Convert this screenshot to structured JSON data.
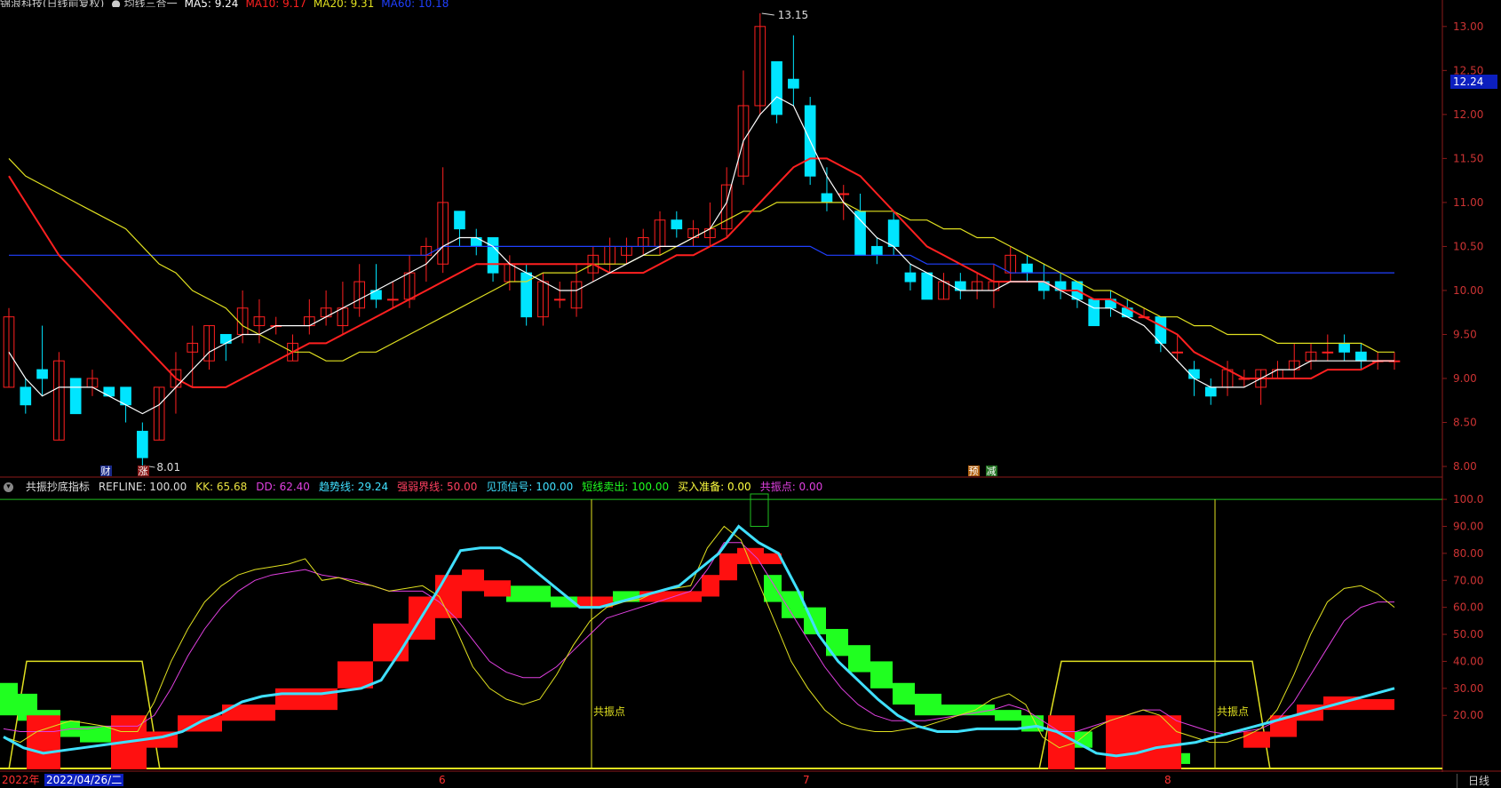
{
  "header": {
    "title_items": [
      {
        "text": "锦浪科技(日线前复权)",
        "color": "#cccccc"
      },
      {
        "text": "● 均线三合一",
        "color": "#cccccc"
      },
      {
        "text": "MA5: 9.24",
        "color": "#ffffff"
      },
      {
        "text": "MA10: 9.17",
        "color": "#ff2020"
      },
      {
        "text": "MA20: 9.31",
        "color": "#e0e020"
      },
      {
        "text": "MA60: 10.18",
        "color": "#2040ff"
      }
    ]
  },
  "indicator_header": {
    "icon": "chevron-down-icon",
    "items": [
      {
        "text": "共振抄底指标",
        "color": "#dddddd"
      },
      {
        "text": "REFLINE: 100.00",
        "color": "#dddddd"
      },
      {
        "text": "KK: 65.68",
        "color": "#e8e040"
      },
      {
        "text": "DD: 62.40",
        "color": "#e040e0"
      },
      {
        "text": "趋势线: 29.24",
        "color": "#40e0ff"
      },
      {
        "text": "强弱界线: 50.00",
        "color": "#ff4060"
      },
      {
        "text": "见顶信号: 100.00",
        "color": "#40e0ff"
      },
      {
        "text": "短线卖出: 100.00",
        "color": "#20ff20"
      },
      {
        "text": "买入准备: 0.00",
        "color": "#ffff40"
      },
      {
        "text": "共振点: 0.00",
        "color": "#e040e0"
      }
    ]
  },
  "price_axis": {
    "ticks": [
      "13.00",
      "12.50",
      "12.00",
      "11.50",
      "11.00",
      "10.50",
      "10.00",
      "9.50",
      "9.00",
      "8.50",
      "8.00"
    ],
    "current": "12.24"
  },
  "indicator_axis": {
    "ticks": [
      "100.0",
      "90.00",
      "80.00",
      "70.00",
      "60.00",
      "50.00",
      "40.00",
      "30.00",
      "20.00"
    ]
  },
  "annotations": {
    "high_label": "13.15",
    "low_label": "8.01",
    "cai": "财",
    "zhang": "涨",
    "yu": "预",
    "jian": "减",
    "gongzhen1": "共振点",
    "gongzhen2": "共振点"
  },
  "bottom_bar": {
    "year": "2022年",
    "date": "2022/04/26/二",
    "months": [
      "6",
      "7",
      "8"
    ],
    "period_button": "日线"
  },
  "colors": {
    "up": "#ff2020",
    "down": "#00e5ff",
    "ma5": "#ffffff",
    "ma10": "#ff2020",
    "ma20": "#e0e020",
    "ma60": "#2040ff"
  },
  "chart_data": [
    {
      "type": "candlestick",
      "title": "锦浪科技(日线前复权)",
      "candles": [
        {
          "o": 8.9,
          "c": 9.7,
          "h": 9.8,
          "l": 8.9
        },
        {
          "o": 8.9,
          "c": 8.7,
          "h": 9.0,
          "l": 8.6
        },
        {
          "o": 9.1,
          "c": 9.0,
          "h": 9.6,
          "l": 8.8
        },
        {
          "o": 8.3,
          "c": 9.2,
          "h": 9.3,
          "l": 8.3
        },
        {
          "o": 9.0,
          "c": 8.6,
          "h": 9.0,
          "l": 8.6
        },
        {
          "o": 8.9,
          "c": 9.0,
          "h": 9.1,
          "l": 8.8
        },
        {
          "o": 8.9,
          "c": 8.8,
          "h": 8.9,
          "l": 8.8
        },
        {
          "o": 8.9,
          "c": 8.7,
          "h": 8.9,
          "l": 8.5
        },
        {
          "o": 8.4,
          "c": 8.1,
          "h": 8.5,
          "l": 8.01
        },
        {
          "o": 8.3,
          "c": 8.9,
          "h": 8.9,
          "l": 8.3
        },
        {
          "o": 8.9,
          "c": 9.1,
          "h": 9.3,
          "l": 8.6
        },
        {
          "o": 9.3,
          "c": 9.4,
          "h": 9.6,
          "l": 8.9
        },
        {
          "o": 9.2,
          "c": 9.6,
          "h": 9.6,
          "l": 9.1
        },
        {
          "o": 9.5,
          "c": 9.4,
          "h": 9.5,
          "l": 9.2
        },
        {
          "o": 9.5,
          "c": 9.8,
          "h": 10.0,
          "l": 9.4
        },
        {
          "o": 9.6,
          "c": 9.7,
          "h": 9.9,
          "l": 9.4
        },
        {
          "o": 9.6,
          "c": 9.6,
          "h": 9.7,
          "l": 9.5
        },
        {
          "o": 9.2,
          "c": 9.4,
          "h": 9.5,
          "l": 9.2
        },
        {
          "o": 9.6,
          "c": 9.7,
          "h": 9.9,
          "l": 9.5
        },
        {
          "o": 9.7,
          "c": 9.8,
          "h": 10.0,
          "l": 9.6
        },
        {
          "o": 9.6,
          "c": 9.8,
          "h": 10.1,
          "l": 9.5
        },
        {
          "o": 9.8,
          "c": 10.1,
          "h": 10.3,
          "l": 9.7
        },
        {
          "o": 10.0,
          "c": 9.9,
          "h": 10.3,
          "l": 9.8
        },
        {
          "o": 9.9,
          "c": 9.9,
          "h": 10.1,
          "l": 9.8
        },
        {
          "o": 9.9,
          "c": 10.2,
          "h": 10.4,
          "l": 9.8
        },
        {
          "o": 10.4,
          "c": 10.5,
          "h": 10.6,
          "l": 10.1
        },
        {
          "o": 10.3,
          "c": 11.0,
          "h": 11.4,
          "l": 10.2
        },
        {
          "o": 10.9,
          "c": 10.7,
          "h": 10.9,
          "l": 10.5
        },
        {
          "o": 10.6,
          "c": 10.5,
          "h": 10.7,
          "l": 10.4
        },
        {
          "o": 10.6,
          "c": 10.2,
          "h": 10.6,
          "l": 10.1
        },
        {
          "o": 10.1,
          "c": 10.3,
          "h": 10.4,
          "l": 10.0
        },
        {
          "o": 10.2,
          "c": 9.7,
          "h": 10.3,
          "l": 9.6
        },
        {
          "o": 9.7,
          "c": 10.1,
          "h": 10.2,
          "l": 9.6
        },
        {
          "o": 9.9,
          "c": 9.9,
          "h": 10.1,
          "l": 9.8
        },
        {
          "o": 9.8,
          "c": 10.1,
          "h": 10.3,
          "l": 9.7
        },
        {
          "o": 10.2,
          "c": 10.4,
          "h": 10.5,
          "l": 10.1
        },
        {
          "o": 10.3,
          "c": 10.5,
          "h": 10.6,
          "l": 10.2
        },
        {
          "o": 10.4,
          "c": 10.5,
          "h": 10.6,
          "l": 10.3
        },
        {
          "o": 10.5,
          "c": 10.6,
          "h": 10.7,
          "l": 10.4
        },
        {
          "o": 10.5,
          "c": 10.8,
          "h": 10.9,
          "l": 10.4
        },
        {
          "o": 10.8,
          "c": 10.7,
          "h": 10.9,
          "l": 10.6
        },
        {
          "o": 10.6,
          "c": 10.7,
          "h": 10.8,
          "l": 10.5
        },
        {
          "o": 10.6,
          "c": 10.7,
          "h": 11.0,
          "l": 10.5
        },
        {
          "o": 10.7,
          "c": 11.2,
          "h": 11.4,
          "l": 10.6
        },
        {
          "o": 11.3,
          "c": 12.1,
          "h": 12.5,
          "l": 11.2
        },
        {
          "o": 12.1,
          "c": 13.0,
          "h": 13.15,
          "l": 12.0
        },
        {
          "o": 12.6,
          "c": 12.0,
          "h": 12.6,
          "l": 11.9
        },
        {
          "o": 12.4,
          "c": 12.3,
          "h": 12.9,
          "l": 12.1
        },
        {
          "o": 12.1,
          "c": 11.3,
          "h": 12.2,
          "l": 11.2
        },
        {
          "o": 11.1,
          "c": 11.0,
          "h": 11.4,
          "l": 10.9
        },
        {
          "o": 11.1,
          "c": 11.1,
          "h": 11.2,
          "l": 10.8
        },
        {
          "o": 10.9,
          "c": 10.4,
          "h": 11.1,
          "l": 10.4
        },
        {
          "o": 10.5,
          "c": 10.4,
          "h": 10.6,
          "l": 10.3
        },
        {
          "o": 10.8,
          "c": 10.5,
          "h": 10.9,
          "l": 10.4
        },
        {
          "o": 10.2,
          "c": 10.1,
          "h": 10.3,
          "l": 10.0
        },
        {
          "o": 10.2,
          "c": 9.9,
          "h": 10.2,
          "l": 9.9
        },
        {
          "o": 9.9,
          "c": 10.1,
          "h": 10.2,
          "l": 9.9
        },
        {
          "o": 10.1,
          "c": 10.0,
          "h": 10.2,
          "l": 9.9
        },
        {
          "o": 10.0,
          "c": 10.1,
          "h": 10.2,
          "l": 9.9
        },
        {
          "o": 10.0,
          "c": 10.1,
          "h": 10.3,
          "l": 9.8
        },
        {
          "o": 10.2,
          "c": 10.4,
          "h": 10.5,
          "l": 10.1
        },
        {
          "o": 10.3,
          "c": 10.2,
          "h": 10.4,
          "l": 10.1
        },
        {
          "o": 10.1,
          "c": 10.0,
          "h": 10.3,
          "l": 9.9
        },
        {
          "o": 10.1,
          "c": 10.0,
          "h": 10.2,
          "l": 9.9
        },
        {
          "o": 10.1,
          "c": 9.9,
          "h": 10.1,
          "l": 9.8
        },
        {
          "o": 9.9,
          "c": 9.6,
          "h": 9.9,
          "l": 9.6
        },
        {
          "o": 9.9,
          "c": 9.8,
          "h": 10.0,
          "l": 9.7
        },
        {
          "o": 9.8,
          "c": 9.7,
          "h": 9.9,
          "l": 9.7
        },
        {
          "o": 9.7,
          "c": 9.7,
          "h": 9.8,
          "l": 9.7
        },
        {
          "o": 9.7,
          "c": 9.4,
          "h": 9.7,
          "l": 9.3
        },
        {
          "o": 9.3,
          "c": 9.3,
          "h": 9.5,
          "l": 9.2
        },
        {
          "o": 9.1,
          "c": 9.0,
          "h": 9.2,
          "l": 8.8
        },
        {
          "o": 8.9,
          "c": 8.8,
          "h": 9.0,
          "l": 8.7
        },
        {
          "o": 8.9,
          "c": 9.1,
          "h": 9.2,
          "l": 8.8
        },
        {
          "o": 9.0,
          "c": 9.0,
          "h": 9.1,
          "l": 8.9
        },
        {
          "o": 8.9,
          "c": 9.1,
          "h": 9.1,
          "l": 8.7
        },
        {
          "o": 9.0,
          "c": 9.1,
          "h": 9.2,
          "l": 9.0
        },
        {
          "o": 9.1,
          "c": 9.2,
          "h": 9.4,
          "l": 9.0
        },
        {
          "o": 9.2,
          "c": 9.3,
          "h": 9.4,
          "l": 9.1
        },
        {
          "o": 9.3,
          "c": 9.3,
          "h": 9.5,
          "l": 9.2
        },
        {
          "o": 9.4,
          "c": 9.3,
          "h": 9.5,
          "l": 9.2
        },
        {
          "o": 9.3,
          "c": 9.2,
          "h": 9.4,
          "l": 9.1
        },
        {
          "o": 9.2,
          "c": 9.2,
          "h": 9.3,
          "l": 9.1
        },
        {
          "o": 9.2,
          "c": 9.2,
          "h": 9.3,
          "l": 9.1
        }
      ],
      "ma5": [
        9.3,
        9.0,
        8.8,
        8.9,
        8.9,
        8.9,
        8.8,
        8.7,
        8.6,
        8.7,
        8.9,
        9.1,
        9.3,
        9.4,
        9.5,
        9.5,
        9.6,
        9.6,
        9.6,
        9.7,
        9.8,
        9.9,
        10.0,
        10.1,
        10.2,
        10.3,
        10.5,
        10.6,
        10.6,
        10.5,
        10.3,
        10.2,
        10.1,
        10.0,
        10.0,
        10.1,
        10.2,
        10.3,
        10.4,
        10.5,
        10.5,
        10.6,
        10.7,
        11.0,
        11.7,
        12.0,
        12.2,
        12.1,
        11.7,
        11.3,
        11.0,
        10.8,
        10.6,
        10.5,
        10.3,
        10.2,
        10.1,
        10.0,
        10.0,
        10.0,
        10.1,
        10.1,
        10.1,
        10.0,
        9.9,
        9.8,
        9.8,
        9.7,
        9.6,
        9.4,
        9.2,
        9.0,
        8.9,
        8.9,
        8.9,
        9.0,
        9.1,
        9.1,
        9.2,
        9.2,
        9.2,
        9.2,
        9.2,
        9.2
      ],
      "ma10": [
        11.3,
        11.0,
        10.7,
        10.4,
        10.2,
        10.0,
        9.8,
        9.6,
        9.4,
        9.2,
        9.0,
        8.9,
        8.9,
        8.9,
        9.0,
        9.1,
        9.2,
        9.3,
        9.4,
        9.4,
        9.5,
        9.6,
        9.7,
        9.8,
        9.9,
        10.0,
        10.1,
        10.2,
        10.3,
        10.3,
        10.3,
        10.3,
        10.3,
        10.3,
        10.3,
        10.3,
        10.2,
        10.2,
        10.2,
        10.3,
        10.4,
        10.4,
        10.5,
        10.6,
        10.8,
        11.0,
        11.2,
        11.4,
        11.5,
        11.5,
        11.4,
        11.3,
        11.1,
        10.9,
        10.7,
        10.5,
        10.4,
        10.3,
        10.2,
        10.1,
        10.1,
        10.1,
        10.1,
        10.0,
        10.0,
        9.9,
        9.9,
        9.8,
        9.7,
        9.6,
        9.5,
        9.3,
        9.2,
        9.1,
        9.0,
        9.0,
        9.0,
        9.0,
        9.0,
        9.1,
        9.1,
        9.1,
        9.2,
        9.2
      ],
      "ma20": [
        11.5,
        11.3,
        11.2,
        11.1,
        11.0,
        10.9,
        10.8,
        10.7,
        10.5,
        10.3,
        10.2,
        10.0,
        9.9,
        9.8,
        9.6,
        9.5,
        9.4,
        9.3,
        9.3,
        9.2,
        9.2,
        9.3,
        9.3,
        9.4,
        9.5,
        9.6,
        9.7,
        9.8,
        9.9,
        10.0,
        10.1,
        10.1,
        10.2,
        10.2,
        10.2,
        10.3,
        10.3,
        10.3,
        10.4,
        10.4,
        10.5,
        10.6,
        10.7,
        10.8,
        10.9,
        10.9,
        11.0,
        11.0,
        11.0,
        11.0,
        11.0,
        10.9,
        10.9,
        10.9,
        10.8,
        10.8,
        10.7,
        10.7,
        10.6,
        10.6,
        10.5,
        10.4,
        10.3,
        10.2,
        10.1,
        10.0,
        10.0,
        9.9,
        9.8,
        9.7,
        9.7,
        9.6,
        9.6,
        9.5,
        9.5,
        9.5,
        9.4,
        9.4,
        9.4,
        9.4,
        9.4,
        9.4,
        9.3,
        9.3
      ],
      "ma60": [
        10.4,
        10.4,
        10.4,
        10.4,
        10.4,
        10.4,
        10.4,
        10.4,
        10.4,
        10.4,
        10.4,
        10.4,
        10.4,
        10.4,
        10.4,
        10.4,
        10.4,
        10.4,
        10.4,
        10.4,
        10.4,
        10.4,
        10.4,
        10.4,
        10.4,
        10.4,
        10.5,
        10.5,
        10.5,
        10.5,
        10.5,
        10.5,
        10.5,
        10.5,
        10.5,
        10.5,
        10.5,
        10.5,
        10.5,
        10.5,
        10.5,
        10.5,
        10.5,
        10.5,
        10.5,
        10.5,
        10.5,
        10.5,
        10.5,
        10.4,
        10.4,
        10.4,
        10.4,
        10.4,
        10.4,
        10.3,
        10.3,
        10.3,
        10.3,
        10.3,
        10.2,
        10.2,
        10.2,
        10.2,
        10.2,
        10.2,
        10.2,
        10.2,
        10.2,
        10.2,
        10.2,
        10.2,
        10.2,
        10.2,
        10.2,
        10.2,
        10.2,
        10.2,
        10.2,
        10.2,
        10.2,
        10.2,
        10.2,
        10.2
      ],
      "ylim": [
        7.95,
        13.2
      ]
    },
    {
      "type": "line",
      "title": "共振抄底指标",
      "ylim": [
        0,
        102
      ],
      "kk": [
        12,
        10,
        14,
        16,
        18,
        17,
        16,
        14,
        14,
        25,
        40,
        52,
        62,
        68,
        72,
        74,
        75,
        76,
        78,
        70,
        71,
        69,
        68,
        66,
        67,
        68,
        64,
        52,
        38,
        30,
        26,
        24,
        26,
        35,
        46,
        55,
        60,
        62,
        63,
        66,
        67,
        68,
        82,
        90,
        85,
        70,
        55,
        40,
        30,
        22,
        17,
        15,
        14,
        14,
        15,
        16,
        18,
        20,
        22,
        26,
        28,
        24,
        12,
        8,
        10,
        15,
        18,
        20,
        22,
        20,
        14,
        12,
        10,
        10,
        12,
        15,
        22,
        35,
        50,
        62,
        67,
        68,
        65,
        60
      ],
      "dd": [
        15,
        14,
        14,
        14,
        15,
        15,
        16,
        16,
        16,
        20,
        30,
        42,
        52,
        60,
        66,
        70,
        72,
        73,
        74,
        72,
        71,
        70,
        68,
        66,
        66,
        66,
        62,
        56,
        48,
        40,
        36,
        34,
        34,
        38,
        44,
        50,
        56,
        58,
        60,
        62,
        64,
        66,
        74,
        84,
        84,
        78,
        68,
        58,
        48,
        38,
        30,
        24,
        20,
        18,
        18,
        18,
        19,
        20,
        21,
        22,
        24,
        22,
        18,
        14,
        14,
        16,
        18,
        20,
        22,
        22,
        18,
        16,
        14,
        13,
        14,
        15,
        18,
        25,
        35,
        45,
        55,
        60,
        62,
        62
      ],
      "trend": [
        12,
        8,
        6,
        7,
        8,
        9,
        10,
        11,
        12,
        14,
        18,
        21,
        25,
        27,
        28,
        28,
        28,
        29,
        30,
        33,
        44,
        56,
        68,
        81,
        82,
        82,
        78,
        72,
        66,
        60,
        60,
        62,
        64,
        66,
        68,
        74,
        80,
        90,
        84,
        80,
        66,
        50,
        40,
        33,
        26,
        20,
        16,
        14,
        14,
        15,
        15,
        15,
        16,
        14,
        10,
        6,
        5,
        6,
        8,
        9,
        10,
        12,
        14,
        16,
        18,
        20,
        22,
        24,
        26,
        28,
        30
      ],
      "gongzhen_lines": [
        "共振点",
        "共振点"
      ]
    }
  ]
}
